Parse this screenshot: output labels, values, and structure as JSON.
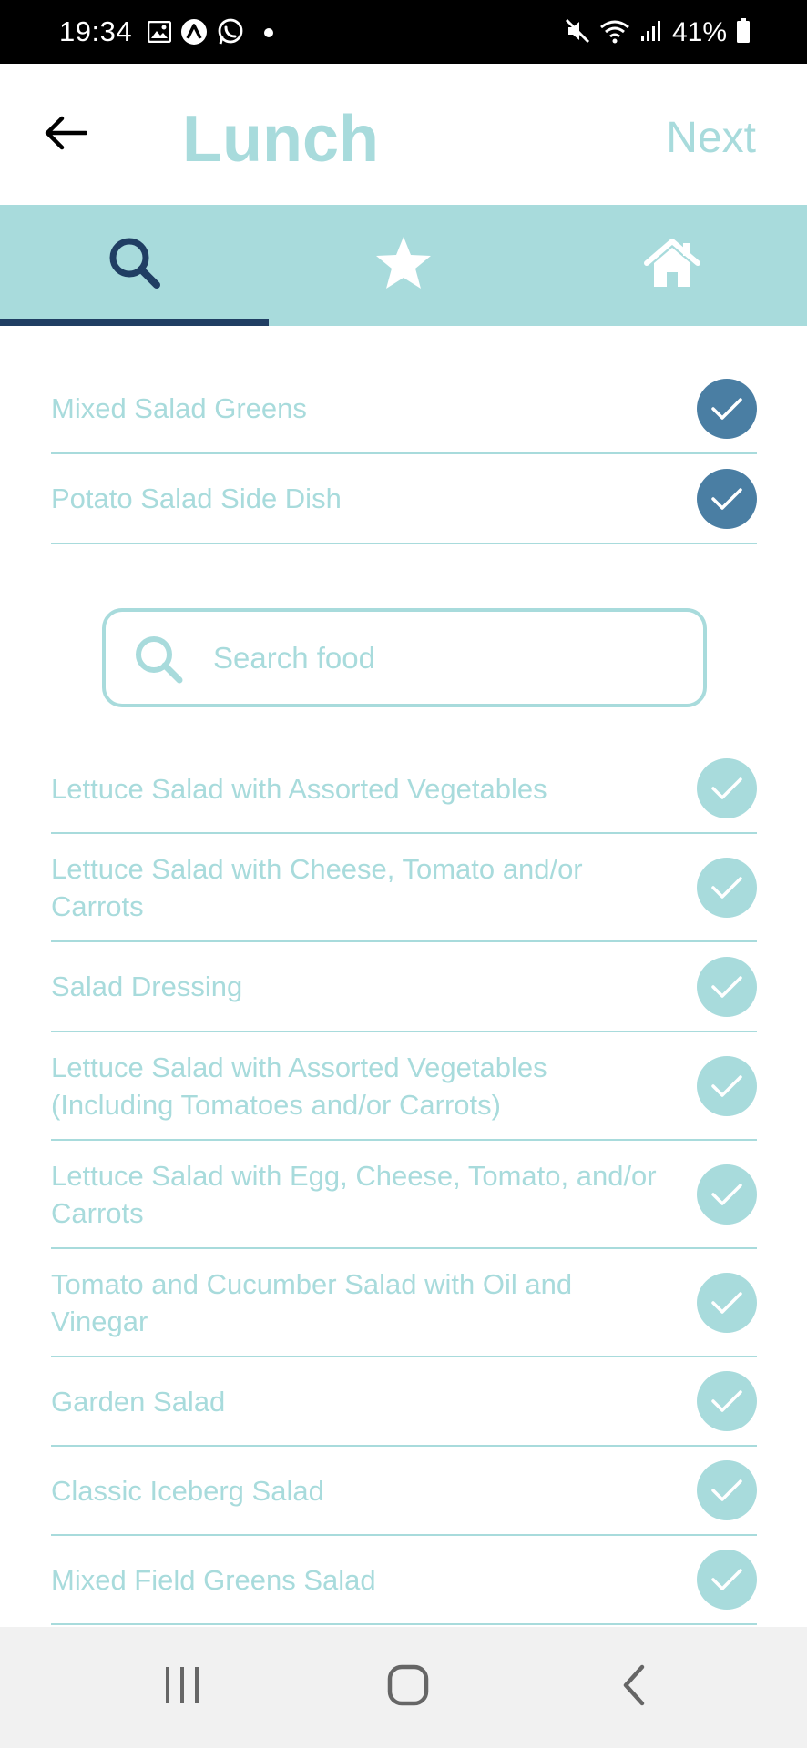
{
  "status_bar": {
    "time": "19:34",
    "battery": "41%",
    "left_icons": [
      "image-icon",
      "a-circle-icon",
      "whatsapp-icon",
      "dot-icon"
    ],
    "right_icons": [
      "mute-icon",
      "wifi-icon",
      "signal-icon",
      "battery-icon"
    ]
  },
  "header": {
    "title": "Lunch",
    "next_label": "Next",
    "back_icon": "back-arrow-icon"
  },
  "tabs": [
    {
      "name": "search",
      "icon": "search-icon",
      "active": true
    },
    {
      "name": "favorites",
      "icon": "star-icon",
      "active": false
    },
    {
      "name": "home",
      "icon": "home-icon",
      "active": false
    }
  ],
  "selected_items": [
    {
      "label": "Mixed Salad Greens",
      "selected": true
    },
    {
      "label": "Potato Salad Side Dish",
      "selected": true
    }
  ],
  "search": {
    "placeholder": "Search food",
    "value": ""
  },
  "results": [
    {
      "label": "Lettuce Salad with Assorted Vegetables",
      "selected": false
    },
    {
      "label": "Lettuce Salad with Cheese, Tomato and/or Carrots",
      "selected": false
    },
    {
      "label": "Salad Dressing",
      "selected": false
    },
    {
      "label": "Lettuce Salad with Assorted Vegetables (Including Tomatoes and/or Carrots)",
      "selected": false
    },
    {
      "label": "Lettuce Salad with Egg, Cheese, Tomato, and/or Carrots",
      "selected": false
    },
    {
      "label": "Tomato and Cucumber Salad with Oil and Vinegar",
      "selected": false
    },
    {
      "label": "Garden Salad",
      "selected": false
    },
    {
      "label": "Classic Iceberg Salad",
      "selected": false
    },
    {
      "label": "Mixed Field Greens Salad",
      "selected": false
    }
  ],
  "colors": {
    "accent": "#a8dbdc",
    "selected_check": "#4a7ea3",
    "active_tab": "#203e63"
  },
  "nav_bar": {
    "buttons": [
      "recents-icon",
      "home-circle-icon",
      "back-chevron-icon"
    ]
  }
}
